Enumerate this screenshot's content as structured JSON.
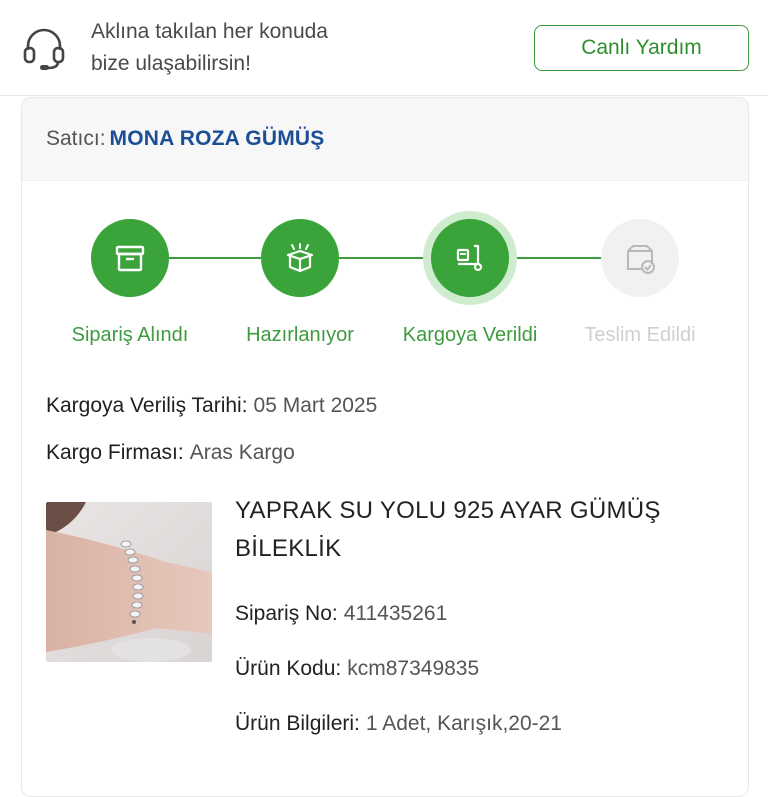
{
  "help": {
    "line1": "Aklına takılan her konuda",
    "line2": "bize ulaşabilirsin!",
    "icon": "headset-icon",
    "button_label": "Canlı Yardım"
  },
  "seller": {
    "label": "Satıcı:",
    "name": "MONA ROZA GÜMÜŞ"
  },
  "steps": [
    {
      "label": "Sipariş Alındı",
      "status": "done",
      "icon": "box-icon"
    },
    {
      "label": "Hazırlanıyor",
      "status": "done",
      "icon": "open-box-icon"
    },
    {
      "label": "Kargoya Verildi",
      "status": "active",
      "icon": "hand-truck-icon"
    },
    {
      "label": "Teslim Edildi",
      "status": "pending",
      "icon": "delivered-box-icon"
    }
  ],
  "shipment": {
    "date_label": "Kargoya Veriliş Tarihi:",
    "date_value": "05 Mart 2025",
    "carrier_label": "Kargo Firması:",
    "carrier_value": "Aras Kargo"
  },
  "product": {
    "title_line1": "YAPRAK SU YOLU 925 AYAR GÜMÜŞ",
    "title_line2": "BİLEKLİK",
    "order_no_label": "Sipariş No:",
    "order_no_value": "411435261",
    "code_label": "Ürün Kodu:",
    "code_value": "kcm87349835",
    "info_label": "Ürün Bilgileri:",
    "info_value": "1 Adet, Karışık,20-21"
  },
  "colors": {
    "accent_green": "#3aa43a",
    "seller_blue": "#1c4e96",
    "pending_gray": "#cfcfcf"
  }
}
